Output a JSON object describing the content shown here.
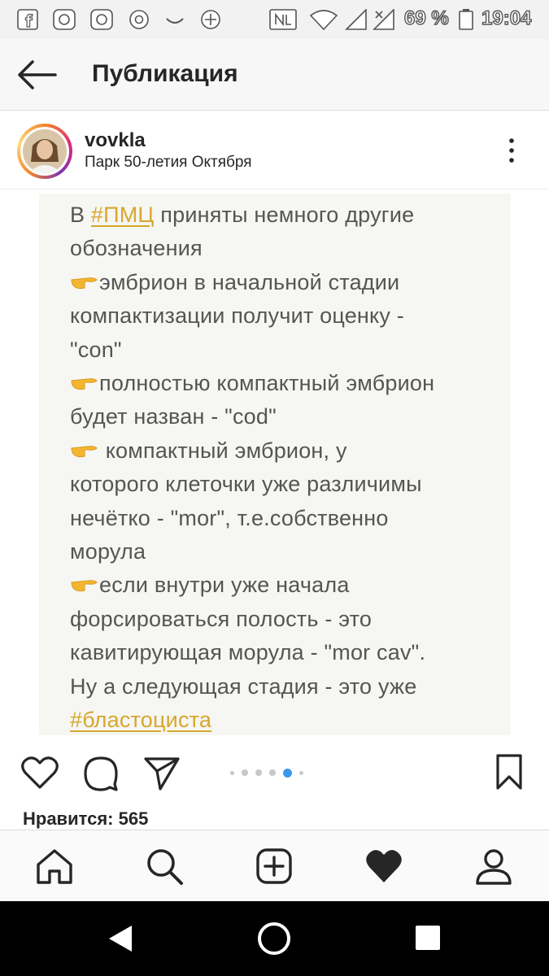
{
  "status_bar": {
    "battery_percent": "69 %",
    "time": "19:04"
  },
  "header": {
    "title": "Публикация"
  },
  "post": {
    "username": "vovkla",
    "location": "Парк 50-летия Октября",
    "note": {
      "l1_pre": "В ",
      "l1_tag": "#ПМЦ",
      "l1_post": " приняты немного другие",
      "l2": "обозначения",
      "l3": "эмбрион в начальной стадии",
      "l4": "компактизации получит оценку -",
      "l5": "\"con\"",
      "l6": "полностью компактный эмбрион",
      "l7": "будет назван - \"cod\"",
      "l8": " компактный эмбрион, у",
      "l9": "которого клеточки уже различимы",
      "l10": "нечётко - \"mor\", т.е.собственно",
      "l11": "морула",
      "l12": "если внутри уже начала",
      "l13": "форсироваться полость - это",
      "l14": "кавитирующая морула - \"mor cav\".",
      "l15": "Ну а следующая стадия - это уже",
      "l16_tag": "#бластоциста"
    },
    "carousel": {
      "total": 6,
      "active_index": 4
    },
    "likes_text": "Нравится: 565"
  },
  "icons": {
    "back": "arrow-left-icon",
    "more": "more-vertical-icon",
    "like": "heart-outline-icon",
    "comment": "comment-icon",
    "share": "send-icon",
    "save": "bookmark-icon",
    "tab_home": "home-icon",
    "tab_search": "search-icon",
    "tab_add": "add-post-icon",
    "tab_activity": "heart-filled-icon",
    "tab_profile": "profile-icon"
  },
  "colors": {
    "hashtag": "#d7a72e",
    "note_text": "#555555",
    "carousel_active": "#3897f0",
    "carousel_inactive": "#c7c7c7"
  }
}
